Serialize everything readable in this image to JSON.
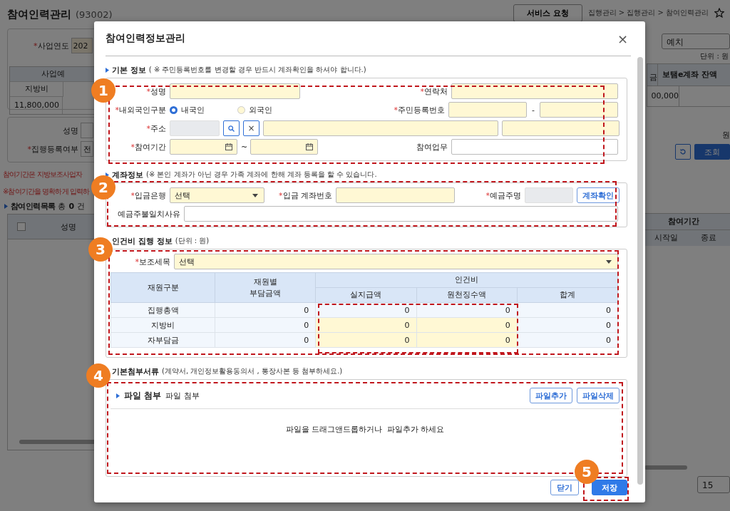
{
  "background": {
    "page_title": "참여인력관리",
    "page_code": "(93002)",
    "service_button": "서비스 요청",
    "breadcrumb": "집행관리 > 집행관리 > 참여인력관리",
    "year": {
      "mark": "*",
      "label": "사업연도",
      "value": "202"
    },
    "budget_table": {
      "group_header": "사업예",
      "column": "지방비",
      "value": "11,800,000"
    },
    "search": {
      "name_label": "성명",
      "status_mark": "*",
      "status_label": "집행등록여부",
      "status_value": "전"
    },
    "notices": [
      "참여기간은 지방보조사업자",
      "※참여기간을 명확하게 입력하"
    ],
    "list": {
      "title": "참여인력목록",
      "total_label": "총",
      "count": "0",
      "unit": "건",
      "select_all": {
        "checked": false
      },
      "columns": [
        "성명"
      ]
    },
    "deposit_select": "예치",
    "unit_note": "단위 : 원",
    "balance_table": {
      "column_1": "금",
      "header": "보탬e계좌 잔액",
      "value": "00,000"
    },
    "cut_label": "원",
    "search_button": "조회",
    "period_header": "참여기간",
    "period_columns": [
      "시작일",
      "종료"
    ],
    "page_size": "15"
  },
  "modal": {
    "title": "참여인력정보관리",
    "close": "×",
    "basic": {
      "heading": "기본 정보",
      "note": "( ※ 주민등록번호를 변경할 경우 반드시 계좌확인을 하셔야 합니다.)",
      "name": {
        "mark": "*",
        "label": "성명"
      },
      "contact": {
        "mark": "*",
        "label": "연락처"
      },
      "nationality": {
        "mark": "*",
        "label": "내외국인구분",
        "options": [
          {
            "label": "내국인",
            "selected": true
          },
          {
            "label": "외국인",
            "selected": false
          }
        ]
      },
      "resident_no": {
        "mark": "*",
        "label": "주민등록번호",
        "separator": "-"
      },
      "address": {
        "mark": "*",
        "label": "주소",
        "clear": "×"
      },
      "period": {
        "mark": "*",
        "label": "참여기간",
        "separator": "~"
      },
      "duty": {
        "label": "참여업무"
      }
    },
    "account": {
      "heading": "계좌정보",
      "note": "(※ 본인 계좌가 아닌 경우 가족 계좌에 한해 계좌 등록을 할 수 있습니다.",
      "bank": {
        "mark": "*",
        "label": "입금은행",
        "value": "선택"
      },
      "account_no": {
        "mark": "*",
        "label": "입금 계좌번호"
      },
      "holder": {
        "mark": "*",
        "label": "예금주명"
      },
      "verify_button": "계좌확인",
      "mismatch": {
        "label": "예금주불일치사유"
      }
    },
    "cost": {
      "heading": "인건비 집행 정보",
      "unit": "(단위 : 원)",
      "item": {
        "mark": "*",
        "label": "보조세목",
        "value": "선택"
      },
      "table": {
        "columns": [
          {
            "label": "재원구분"
          },
          {
            "label": "재원별\n부담금액"
          },
          {
            "label": "인건비",
            "colspan": 3,
            "children": [
              "실지급액",
              "원천징수액",
              "합계"
            ]
          }
        ],
        "rows": [
          {
            "cells": [
              {
                "kind": "label",
                "value": "집행총액"
              },
              {
                "kind": "amount",
                "value": "0",
                "editable": false
              },
              {
                "kind": "amount",
                "value": "0",
                "editable": false
              },
              {
                "kind": "amount",
                "value": "0",
                "editable": false
              },
              {
                "kind": "amount",
                "value": "0",
                "editable": false
              }
            ]
          },
          {
            "cells": [
              {
                "kind": "label",
                "value": "지방비"
              },
              {
                "kind": "amount",
                "value": "0",
                "editable": false
              },
              {
                "kind": "amount",
                "value": "0",
                "editable": true
              },
              {
                "kind": "amount",
                "value": "0",
                "editable": true
              },
              {
                "kind": "amount",
                "value": "0",
                "editable": false
              }
            ]
          },
          {
            "cells": [
              {
                "kind": "label",
                "value": "자부담금"
              },
              {
                "kind": "amount",
                "value": "0",
                "editable": false
              },
              {
                "kind": "amount",
                "value": "0",
                "editable": true
              },
              {
                "kind": "amount",
                "value": "0",
                "editable": true
              },
              {
                "kind": "amount",
                "value": "0",
                "editable": false
              }
            ]
          }
        ]
      }
    },
    "attachments": {
      "heading": "기본첨부서류",
      "note": "(계약서, 개인정보활용동의서 , 통장사본 등 첨부하세요.)",
      "panel_title": "파일 첨부",
      "panel_subtitle": "파일 첨부",
      "buttons": [
        "파일추가",
        "파일삭제"
      ],
      "drop_hint": "파일을 드래그앤드롭하거나  파일추가 하세요"
    },
    "footer_buttons": [
      {
        "label": "닫기",
        "primary": false
      },
      {
        "label": "저장",
        "primary": true
      }
    ]
  },
  "callouts": [
    {
      "number": "1",
      "inner_box": false
    },
    {
      "number": "2",
      "inner_box": false
    },
    {
      "number": "3",
      "inner_box": true
    },
    {
      "number": "4",
      "inner_box": false
    },
    {
      "number": "5",
      "inner_box": false
    }
  ]
}
